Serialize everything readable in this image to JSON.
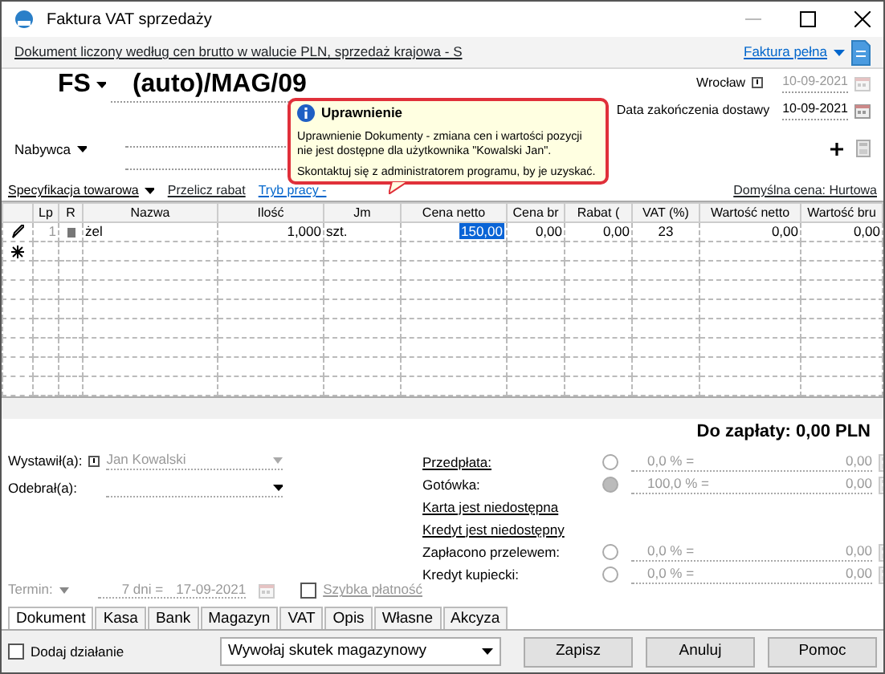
{
  "window": {
    "title": "Faktura VAT sprzedaży"
  },
  "info_bar": {
    "description": "Dokument liczony według cen brutto w walucie PLN, sprzedaż krajowa - S",
    "invoice_type": "Faktura pełna"
  },
  "header": {
    "doc_type": "FS",
    "number": "(auto)/MAG/09",
    "place": "Wrocław",
    "issue_date": "10-09-2021",
    "delivery_label": "Data zakończenia dostawy",
    "delivery_date": "10-09-2021",
    "buyer_label": "Nabywca"
  },
  "toolbar": {
    "specification": "Specyfikacja towarowa",
    "recalc": "Przelicz rabat",
    "mode": "Tryb pracy -",
    "default_price": "Domyślna cena: Hurtowa"
  },
  "tooltip": {
    "title": "Uprawnienie",
    "message": "Uprawnienie Dokumenty - zmiana cen i wartości pozycji nie jest dostępne dla użytkownika \"Kowalski Jan\".",
    "hint": "Skontaktuj się z administratorem programu, by je uzyskać."
  },
  "table": {
    "columns": [
      {
        "label": "Lp",
        "kind": "number"
      },
      {
        "label": "R",
        "kind": "icon"
      },
      {
        "label": "Nazwa",
        "kind": "text"
      },
      {
        "label": "Ilość",
        "kind": "number"
      },
      {
        "label": "Jm",
        "kind": "text"
      },
      {
        "label": "Cena netto",
        "kind": "number"
      },
      {
        "label": "Cena br",
        "kind": "number"
      },
      {
        "label": "Rabat (",
        "kind": "number"
      },
      {
        "label": "VAT (%)",
        "kind": "center"
      },
      {
        "label": "Wartość netto",
        "kind": "number"
      },
      {
        "label": "Wartość bru",
        "kind": "number"
      }
    ],
    "rows": [
      {
        "editing": true,
        "cells": [
          {
            "text": "1",
            "selected": false
          },
          {
            "text": "",
            "selected": false
          },
          {
            "text": "żel",
            "selected": false
          },
          {
            "text": "1,000",
            "selected": false
          },
          {
            "text": "szt.",
            "selected": false
          },
          {
            "text": "150,00",
            "selected": true
          },
          {
            "text": "0,00",
            "selected": false
          },
          {
            "text": "0,00",
            "selected": false
          },
          {
            "text": "23",
            "selected": false
          },
          {
            "text": "0,00",
            "selected": false
          },
          {
            "text": "0,00",
            "selected": false
          }
        ]
      }
    ]
  },
  "total": "Do zapłaty: 0,00 PLN",
  "issued_by": {
    "label": "Wystawił(a):",
    "value": "Jan Kowalski"
  },
  "received_by": {
    "label": "Odebrał(a):"
  },
  "term": {
    "label": "Termin:",
    "days": "7 dni =",
    "date": "17-09-2021"
  },
  "fast_payment": {
    "label": "Szybka płatność",
    "checked": false
  },
  "payments": [
    {
      "label": "Przedpłata:",
      "kind": "method",
      "underlined": true,
      "selected": false,
      "percent": "0,0 % =",
      "amount": "0,00"
    },
    {
      "label": "Gotówka:",
      "kind": "method",
      "underlined": false,
      "selected": true,
      "percent": "100,0 % =",
      "amount": "0,00"
    },
    {
      "label": "Karta jest niedostępna",
      "kind": "note",
      "underlined": true
    },
    {
      "label": "Kredyt jest niedostępny",
      "kind": "note",
      "underlined": true
    },
    {
      "label": "Zapłacono przelewem:",
      "kind": "method",
      "underlined": false,
      "selected": false,
      "percent": "0,0 % =",
      "amount": "0,00"
    },
    {
      "label": "Kredyt kupiecki:",
      "kind": "method",
      "underlined": false,
      "selected": false,
      "percent": "0,0 % =",
      "amount": "0,00"
    }
  ],
  "tabs": [
    {
      "label": "Dokument",
      "selected": true
    },
    {
      "label": "Kasa",
      "selected": false
    },
    {
      "label": "Bank",
      "selected": false
    },
    {
      "label": "Magazyn",
      "selected": false
    },
    {
      "label": "VAT",
      "selected": false
    },
    {
      "label": "Opis",
      "selected": false
    },
    {
      "label": "Własne",
      "selected": false
    },
    {
      "label": "Akcyza",
      "selected": false
    }
  ],
  "action": {
    "label": "Dodaj działanie",
    "checked": false
  },
  "stock_effect": "Wywołaj skutek magazynowy",
  "buttons": [
    "Zapisz",
    "Anuluj",
    "Pomoc"
  ]
}
